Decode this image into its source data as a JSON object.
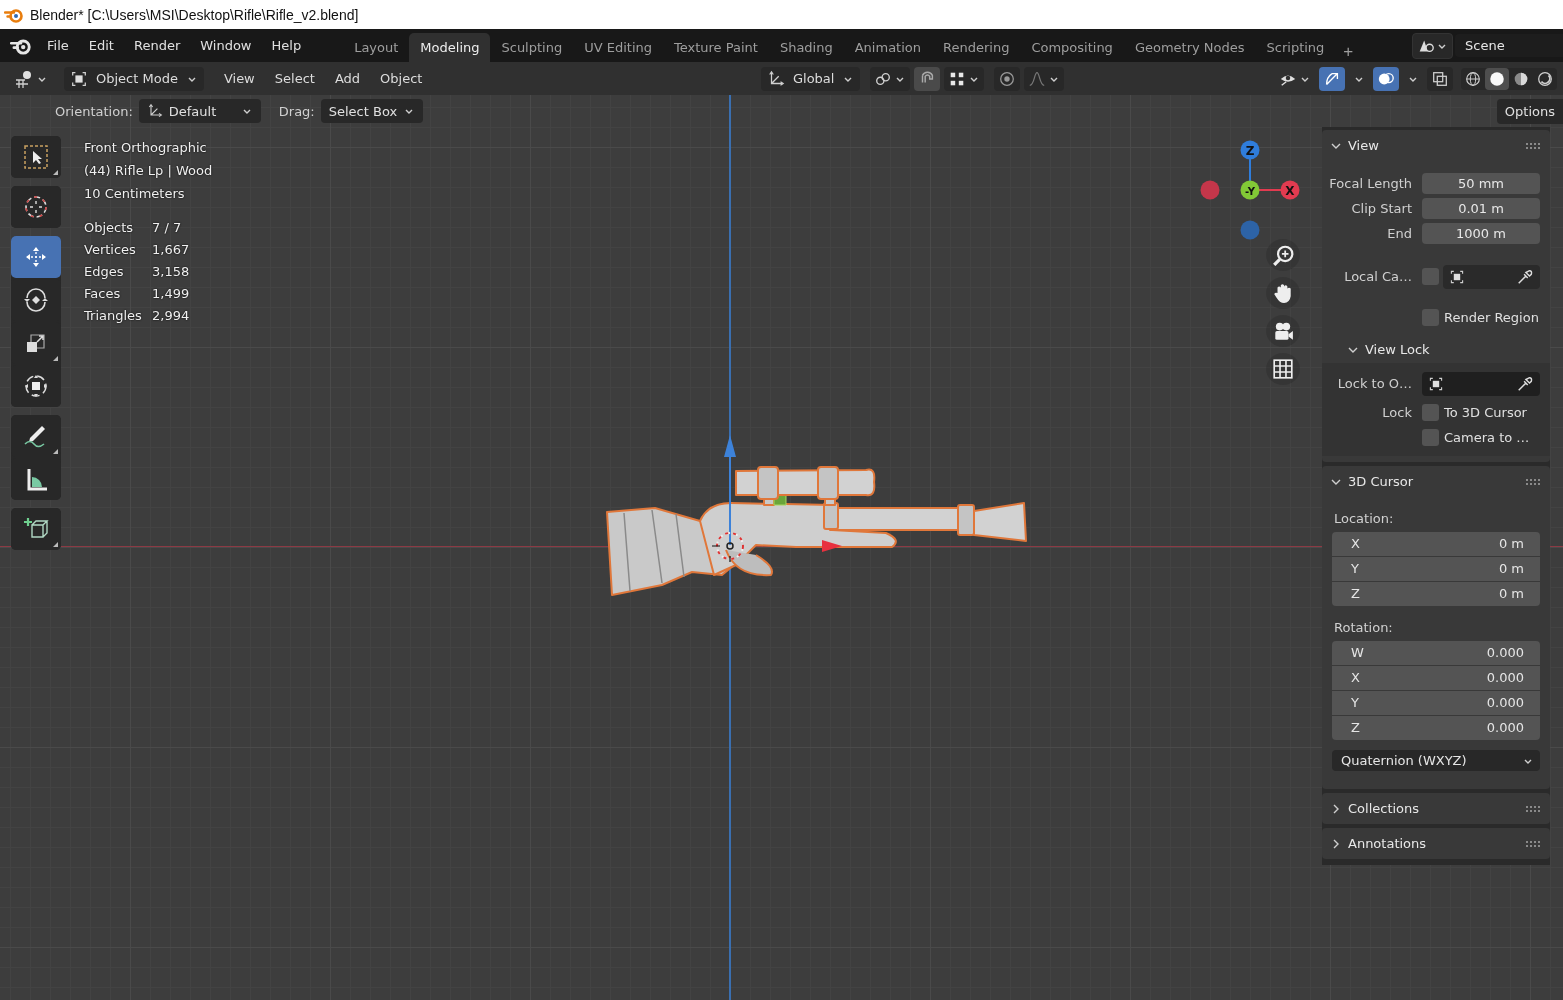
{
  "window": {
    "title": "Blender* [C:\\Users\\MSI\\Desktop\\Rifle\\Rifle_v2.blend]"
  },
  "menu": [
    "File",
    "Edit",
    "Render",
    "Window",
    "Help"
  ],
  "workspaces": [
    {
      "label": "Layout",
      "selected": false
    },
    {
      "label": "Modeling",
      "selected": true
    },
    {
      "label": "Sculpting",
      "selected": false
    },
    {
      "label": "UV Editing",
      "selected": false
    },
    {
      "label": "Texture Paint",
      "selected": false
    },
    {
      "label": "Shading",
      "selected": false
    },
    {
      "label": "Animation",
      "selected": false
    },
    {
      "label": "Rendering",
      "selected": false
    },
    {
      "label": "Compositing",
      "selected": false
    },
    {
      "label": "Geometry Nodes",
      "selected": false
    },
    {
      "label": "Scripting",
      "selected": false
    }
  ],
  "add_workspace": "+",
  "scene": "Scene",
  "header": {
    "mode": "Object Mode",
    "menus": [
      "View",
      "Select",
      "Add",
      "Object"
    ],
    "orientation": "Global",
    "snapping": [
      {
        "kind": "pivot"
      },
      {
        "kind": "snap"
      },
      {
        "kind": "snap_target"
      },
      {
        "kind": "proportional"
      },
      {
        "kind": "falloff"
      }
    ],
    "toggles": [
      {
        "kind": "visibility",
        "on": false
      },
      {
        "kind": "gizmos",
        "on": true
      },
      {
        "kind": "overlays",
        "on": true
      },
      {
        "kind": "xray",
        "on": false
      }
    ],
    "shading": [
      {
        "kind": "wireframe",
        "selected": false
      },
      {
        "kind": "solid",
        "selected": true
      },
      {
        "kind": "material",
        "selected": false
      },
      {
        "kind": "rendered",
        "selected": false
      }
    ]
  },
  "tool_settings": {
    "orientation_label": "Orientation:",
    "orientation": "Default",
    "drag_label": "Drag:",
    "drag": "Select Box",
    "options": "Options"
  },
  "tools": [
    [
      {
        "kind": "select_box",
        "selected": false,
        "variants": true
      }
    ],
    [
      {
        "kind": "cursor",
        "selected": false,
        "variants": false
      }
    ],
    [
      {
        "kind": "move",
        "selected": true,
        "variants": false
      },
      {
        "kind": "rotate",
        "selected": false,
        "variants": false
      },
      {
        "kind": "scale",
        "selected": false,
        "variants": true
      },
      {
        "kind": "transform",
        "selected": false,
        "variants": false
      }
    ],
    [
      {
        "kind": "annotate",
        "selected": false,
        "variants": true
      },
      {
        "kind": "measure",
        "selected": false,
        "variants": false
      }
    ],
    [
      {
        "kind": "add_cube",
        "selected": false,
        "variants": true
      }
    ]
  ],
  "viewport_info": [
    "Front Orthographic",
    "(44) Rifle Lp | Wood",
    "10 Centimeters"
  ],
  "stats": [
    {
      "label": "Objects",
      "value": "7 / 7"
    },
    {
      "label": "Vertices",
      "value": "1,667"
    },
    {
      "label": "Edges",
      "value": "3,158"
    },
    {
      "label": "Faces",
      "value": "1,499"
    },
    {
      "label": "Triangles",
      "value": "2,994"
    }
  ],
  "gizmo": [
    {
      "kind": "neg_x",
      "color": "#c5364a"
    },
    {
      "kind": "neg_z",
      "color": "#2d63a6"
    },
    {
      "kind": "pos_z",
      "label": "Z",
      "color": "#2f7ddb"
    },
    {
      "kind": "pos_x",
      "label": "X",
      "color": "#e23b50"
    },
    {
      "kind": "neg_y",
      "label": "-Y",
      "color": "#82c936"
    }
  ],
  "navigation": [
    {
      "kind": "zoom"
    },
    {
      "kind": "pan"
    },
    {
      "kind": "camera"
    },
    {
      "kind": "ortho"
    }
  ],
  "sidebar": {
    "panels": [
      {
        "title": "View",
        "expanded": true,
        "rows": [
          {
            "kind": "number",
            "label": "Focal Length",
            "value": "50 mm"
          },
          {
            "kind": "number",
            "label": "Clip Start",
            "value": "0.01 m"
          },
          {
            "kind": "number",
            "label": "End",
            "value": "1000 m"
          },
          {
            "kind": "object",
            "label": "Local Ca…",
            "checked": false
          },
          {
            "kind": "checkbox",
            "text": "Render Region",
            "checked": false
          },
          {
            "kind": "subpanel",
            "title": "View Lock",
            "expanded": true,
            "rows": [
              {
                "kind": "object",
                "label": "Lock to O…"
              },
              {
                "kind": "checkbox",
                "label": "Lock",
                "text": "To 3D Cursor",
                "checked": false
              },
              {
                "kind": "checkbox",
                "text": "Camera to …",
                "checked": false
              }
            ]
          }
        ]
      },
      {
        "title": "3D Cursor",
        "expanded": true,
        "rows": [
          {
            "kind": "heading",
            "text": "Location:"
          },
          {
            "kind": "vector",
            "fields": [
              {
                "axis": "X",
                "value": "0 m"
              },
              {
                "axis": "Y",
                "value": "0 m"
              },
              {
                "axis": "Z",
                "value": "0 m"
              }
            ]
          },
          {
            "kind": "heading",
            "text": "Rotation:"
          },
          {
            "kind": "vector",
            "fields": [
              {
                "axis": "W",
                "value": "0.000"
              },
              {
                "axis": "X",
                "value": "0.000"
              },
              {
                "axis": "Y",
                "value": "0.000"
              },
              {
                "axis": "Z",
                "value": "0.000"
              }
            ]
          },
          {
            "kind": "dropdown",
            "value": "Quaternion (WXYZ)"
          }
        ]
      },
      {
        "title": "Collections",
        "expanded": false
      },
      {
        "title": "Annotations",
        "expanded": false
      }
    ]
  }
}
